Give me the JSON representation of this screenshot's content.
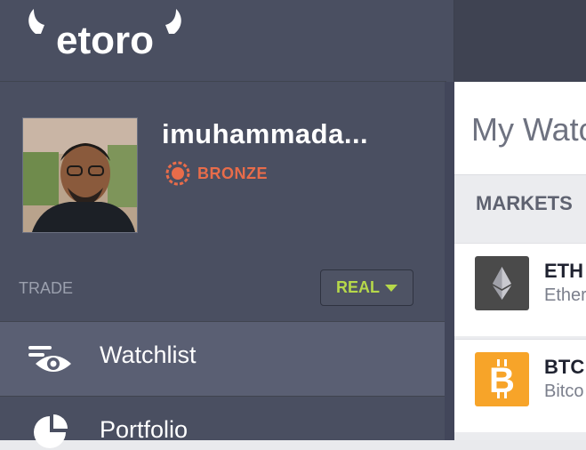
{
  "brand": {
    "logo_text": "eToro"
  },
  "user": {
    "username": "imuhammada...",
    "tier": "BRONZE"
  },
  "account": {
    "trade_label": "TRADE",
    "mode": "REAL"
  },
  "nav": {
    "items": [
      {
        "label": "Watchlist",
        "icon": "eye-icon",
        "active": true
      },
      {
        "label": "Portfolio",
        "icon": "pie-chart-icon",
        "active": false
      }
    ]
  },
  "watchlist": {
    "title": "My Watc",
    "section": "MARKETS",
    "rows": [
      {
        "symbol": "ETH",
        "name": "Ether",
        "icon": "ethereum-icon",
        "color": "#4a4a4a"
      },
      {
        "symbol": "BTC",
        "name": "Bitco",
        "icon": "bitcoin-icon",
        "color": "#f7a429"
      }
    ]
  },
  "colors": {
    "sidebar": "#4a4f61",
    "active_nav": "#5a5f73",
    "bronze": "#e86c4a",
    "real": "#b6d84a"
  }
}
